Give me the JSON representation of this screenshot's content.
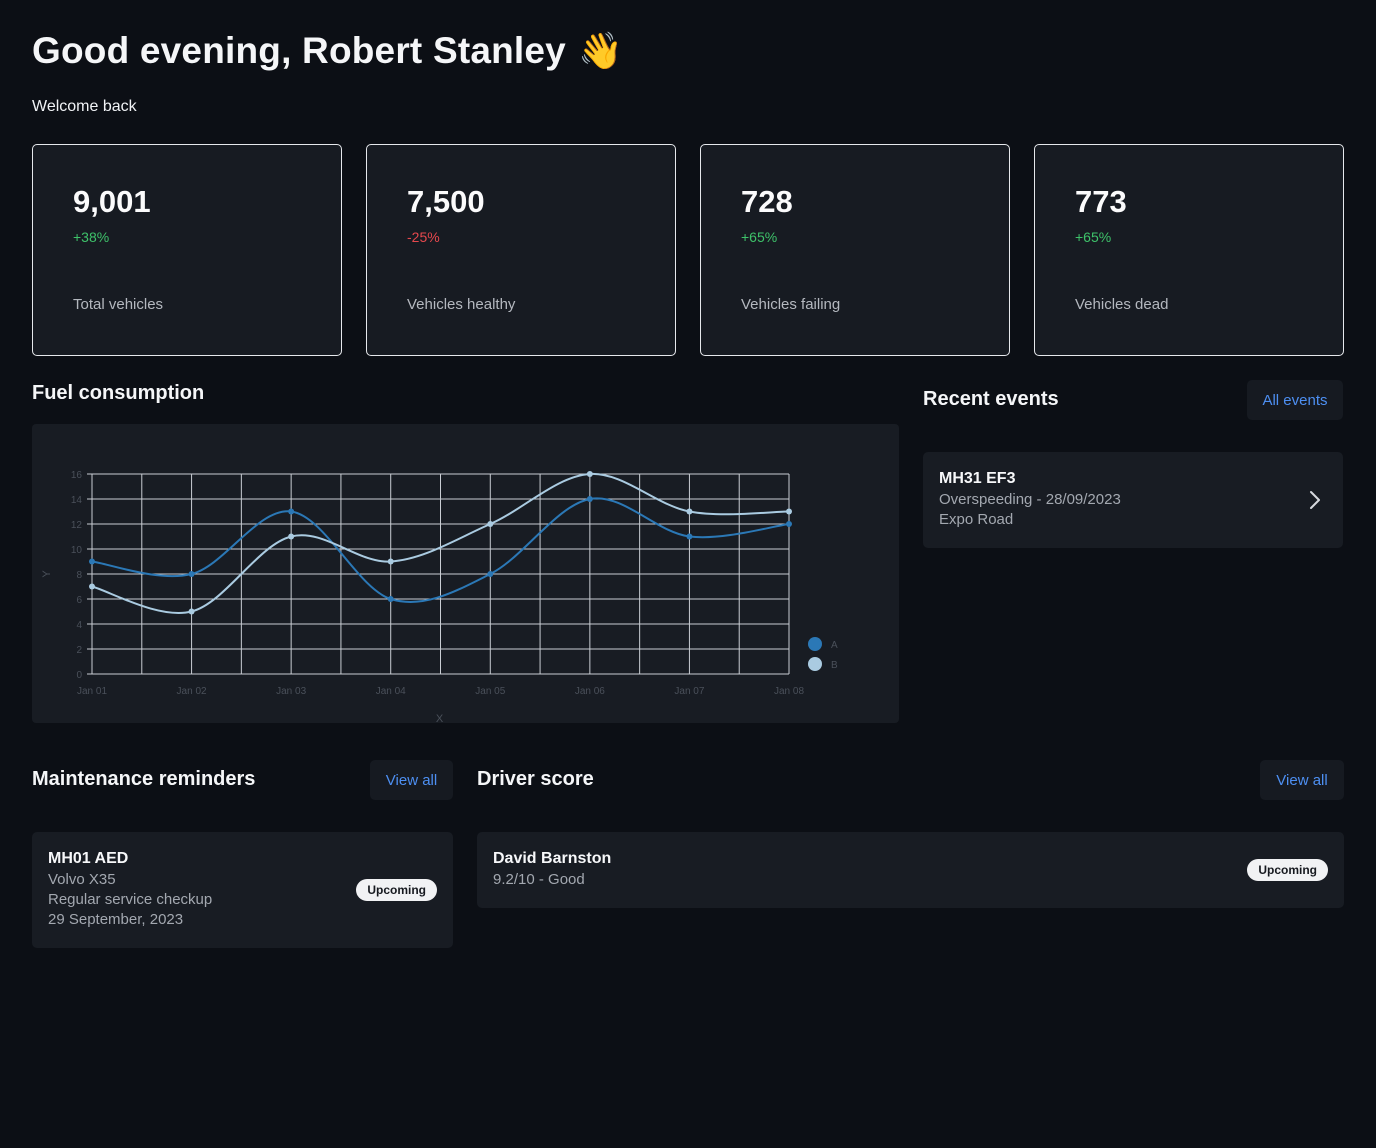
{
  "header": {
    "greeting": "Good evening, Robert Stanley",
    "wave_emoji": "👋",
    "subtitle": "Welcome back"
  },
  "stats": [
    {
      "value": "9,001",
      "delta": "+38%",
      "delta_color": "#3ec26a",
      "label": "Total vehicles"
    },
    {
      "value": "7,500",
      "delta": "-25%",
      "delta_color": "#e5484d",
      "label": "Vehicles healthy"
    },
    {
      "value": "728",
      "delta": "+65%",
      "delta_color": "#3ec26a",
      "label": "Vehicles failing"
    },
    {
      "value": "773",
      "delta": "+65%",
      "delta_color": "#3ec26a",
      "label": "Vehicles dead"
    }
  ],
  "fuel": {
    "title": "Fuel consumption"
  },
  "chart_data": {
    "type": "line",
    "title": "",
    "xlabel": "X",
    "ylabel": "Y",
    "x": [
      "Jan 01",
      "Jan 02",
      "Jan 03",
      "Jan 04",
      "Jan 05",
      "Jan 06",
      "Jan 07",
      "Jan 08"
    ],
    "ylim": [
      0,
      16
    ],
    "yticks": [
      0,
      2,
      4,
      6,
      8,
      10,
      12,
      14,
      16
    ],
    "grid": true,
    "legend": "right",
    "series": [
      {
        "name": "A",
        "color": "#2b78b6",
        "values": [
          9,
          8,
          13,
          6,
          8,
          14,
          11,
          12
        ]
      },
      {
        "name": "B",
        "color": "#aacbe1",
        "values": [
          7,
          5,
          11,
          9,
          12,
          16,
          13,
          13
        ]
      }
    ]
  },
  "events": {
    "title": "Recent events",
    "all_label": "All events",
    "items": [
      {
        "plate": "MH31 EF3",
        "detail": "Overspeeding - 28/09/2023",
        "location": "Expo Road"
      }
    ]
  },
  "maintenance": {
    "title": "Maintenance reminders",
    "view_all": "View all",
    "items": [
      {
        "plate": "MH01 AED",
        "model": "Volvo X35",
        "service": "Regular service checkup",
        "date": "29 September, 2023",
        "status": "Upcoming"
      }
    ]
  },
  "driver_score": {
    "title": "Driver score",
    "view_all": "View all",
    "items": [
      {
        "name": "David Barnston",
        "score": "9.2/10 - Good",
        "status": "Upcoming"
      }
    ]
  },
  "icons": {
    "chevron": "chevron-right-icon"
  }
}
